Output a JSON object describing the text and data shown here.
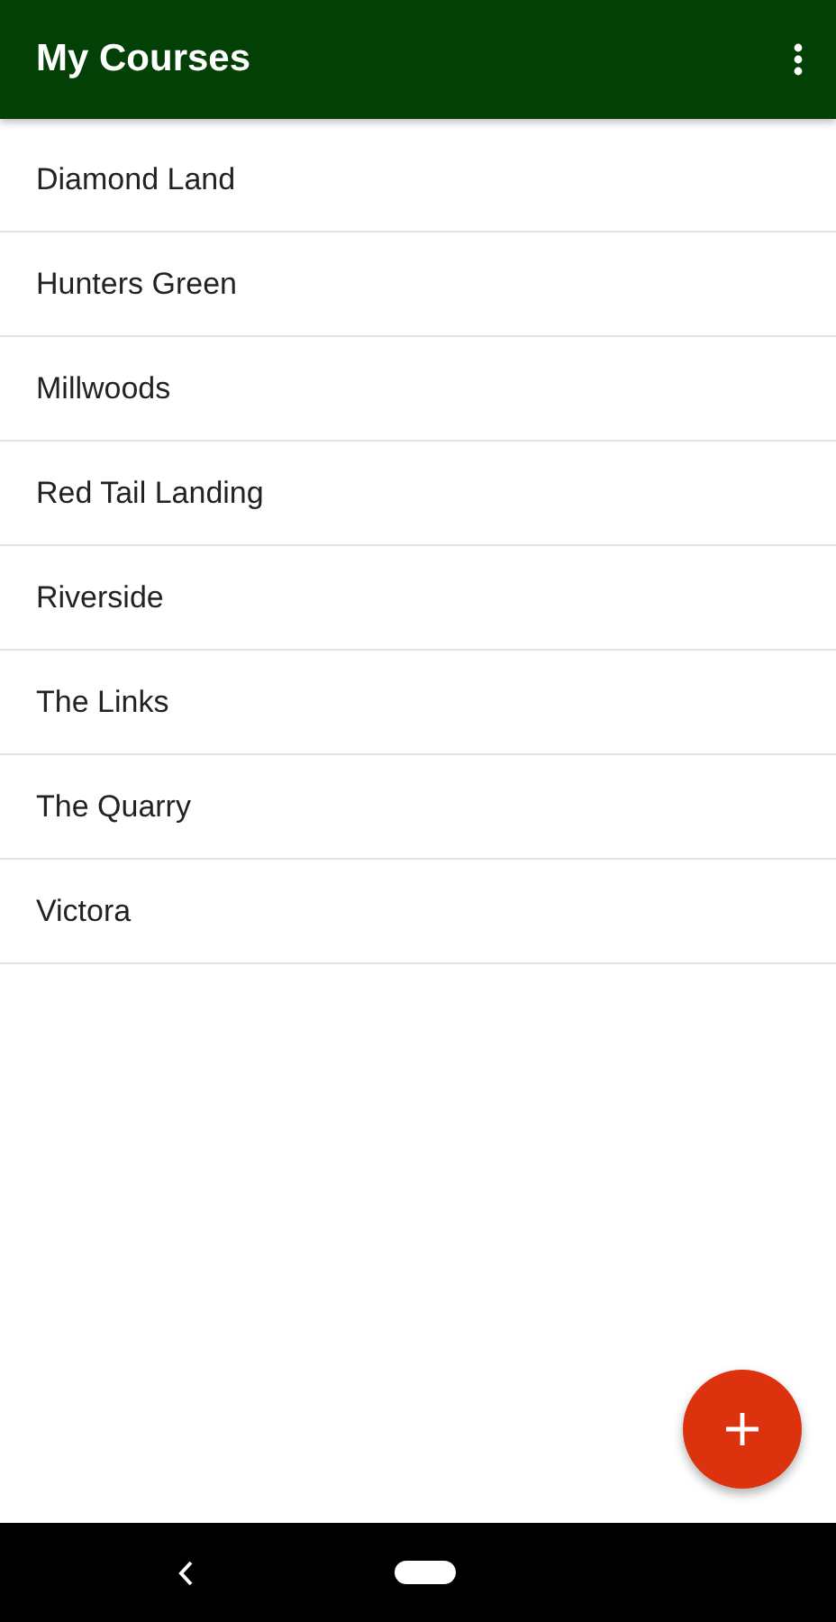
{
  "app_bar": {
    "title": "My Courses"
  },
  "courses": [
    "Diamond Land",
    "Hunters Green",
    "Millwoods",
    "Red Tail Landing",
    "Riverside",
    "The Links",
    "The Quarry",
    "Victora"
  ]
}
